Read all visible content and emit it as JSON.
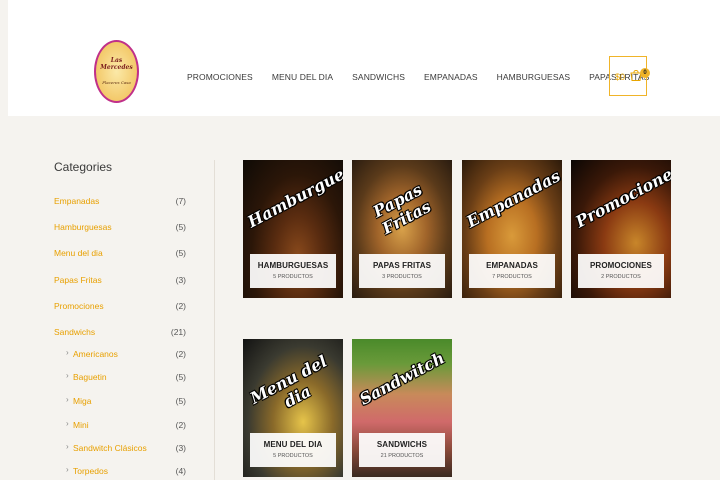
{
  "logo": {
    "line1": "Las Mercedes",
    "line2": "Placeres Casa"
  },
  "nav": {
    "items": [
      "PROMOCIONES",
      "MENU DEL DIA",
      "SANDWICHS",
      "EMPANADAS",
      "HAMBURGUESAS",
      "PAPAS FRITAS"
    ]
  },
  "cart": {
    "amount": "$0",
    "count": "0"
  },
  "sidebar": {
    "title": "Categories",
    "items": [
      {
        "label": "Empanadas",
        "count": "(7)"
      },
      {
        "label": "Hamburguesas",
        "count": "(5)"
      },
      {
        "label": "Menu del dia",
        "count": "(5)"
      },
      {
        "label": "Papas Fritas",
        "count": "(3)"
      },
      {
        "label": "Promociones",
        "count": "(2)"
      },
      {
        "label": "Sandwichs",
        "count": "(21)"
      }
    ],
    "subitems": [
      {
        "label": "Americanos",
        "count": "(2)"
      },
      {
        "label": "Baguetin",
        "count": "(5)"
      },
      {
        "label": "Miga",
        "count": "(5)"
      },
      {
        "label": "Mini",
        "count": "(2)"
      },
      {
        "label": "Sandwitch Clásicos",
        "count": "(3)"
      },
      {
        "label": "Torpedos",
        "count": "(4)"
      }
    ]
  },
  "products": [
    {
      "script": "Hamburguesas",
      "name": "HAMBURGUESAS",
      "count": "5 PRODUCTOS"
    },
    {
      "script": "Papas Fritas",
      "name": "PAPAS FRITAS",
      "count": "3 PRODUCTOS"
    },
    {
      "script": "Empanadas",
      "name": "EMPANADAS",
      "count": "7 PRODUCTOS"
    },
    {
      "script": "Promociones",
      "name": "PROMOCIONES",
      "count": "2 PRODUCTOS"
    },
    {
      "script": "Menu del dia",
      "name": "MENU DEL DIA",
      "count": "5 PRODUCTOS"
    },
    {
      "script": "Sandwitch",
      "name": "SANDWICHS",
      "count": "21 PRODUCTOS"
    }
  ],
  "colors": {
    "accent": "#e8a000",
    "background": "#f5f3ef",
    "cart_border": "#f0b429"
  }
}
